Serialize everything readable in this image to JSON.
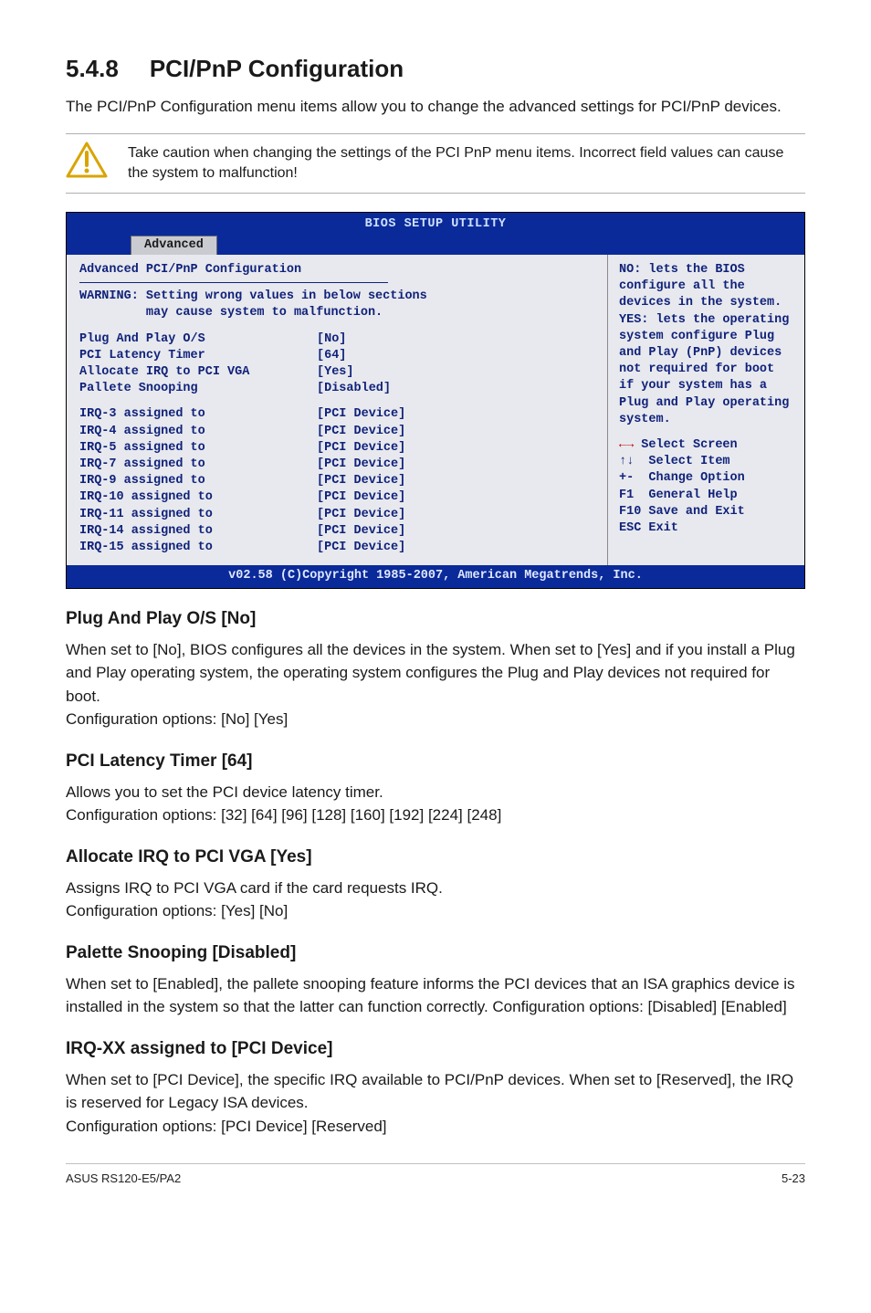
{
  "section": {
    "number": "5.4.8",
    "title": "PCI/PnP Configuration",
    "lead": "The PCI/PnP Configuration menu items allow you to change the advanced settings for PCI/PnP devices.",
    "note": "Take caution when changing the settings of the PCI PnP menu items. Incorrect field values can cause the system to malfunction!"
  },
  "bios": {
    "title": "BIOS SETUP UTILITY",
    "tab": "Advanced",
    "left_header": "Advanced PCI/PnP Configuration",
    "warning_line1": "WARNING: Setting wrong values in below sections",
    "warning_line2": "         may cause system to malfunction.",
    "group1": [
      {
        "label": "Plug And Play O/S",
        "value": "[No]"
      },
      {
        "label": "PCI Latency Timer",
        "value": "[64]"
      },
      {
        "label": "Allocate IRQ to PCI VGA",
        "value": "[Yes]"
      },
      {
        "label": "Pallete Snooping",
        "value": "[Disabled]"
      }
    ],
    "group2": [
      {
        "label": "IRQ-3 assigned to",
        "value": "[PCI Device]"
      },
      {
        "label": "IRQ-4 assigned to",
        "value": "[PCI Device]"
      },
      {
        "label": "IRQ-5 assigned to",
        "value": "[PCI Device]"
      },
      {
        "label": "IRQ-7 assigned to",
        "value": "[PCI Device]"
      },
      {
        "label": "IRQ-9 assigned to",
        "value": "[PCI Device]"
      },
      {
        "label": "IRQ-10 assigned to",
        "value": "[PCI Device]"
      },
      {
        "label": "IRQ-11 assigned to",
        "value": "[PCI Device]"
      },
      {
        "label": "IRQ-14 assigned to",
        "value": "[PCI Device]"
      },
      {
        "label": "IRQ-15 assigned to",
        "value": "[PCI Device]"
      }
    ],
    "help_top": "NO: lets the BIOS configure all the devices in the system. YES: lets the operating system configure Plug and Play (PnP) devices not required for boot if your system has a Plug and Play operating system.",
    "keys": {
      "select_screen": " Select Screen",
      "select_item": "  Select Item",
      "change_option": "+-  Change Option",
      "general_help": "F1  General Help",
      "save_exit": "F10 Save and Exit",
      "esc_exit": "ESC Exit"
    },
    "copyright": "v02.58 (C)Copyright 1985-2007, American Megatrends, Inc."
  },
  "subs": [
    {
      "heading": "Plug And Play O/S [No]",
      "body": "When set to [No], BIOS configures all the devices in the system. When set to [Yes] and if you install a Plug and Play operating system, the operating system configures the Plug and Play devices not required for boot.\nConfiguration options: [No] [Yes]"
    },
    {
      "heading": "PCI Latency Timer [64]",
      "body": "Allows you to set the PCI device latency timer.\nConfiguration options: [32] [64] [96] [128] [160] [192] [224] [248]"
    },
    {
      "heading": "Allocate IRQ to PCI VGA [Yes]",
      "body": "Assigns IRQ to PCI VGA card if the card requests IRQ.\nConfiguration options: [Yes] [No]"
    },
    {
      "heading": "Palette Snooping [Disabled]",
      "body": "When set to [Enabled], the pallete snooping feature informs the PCI devices that an ISA graphics device is installed in the system so that the latter can function correctly. Configuration options: [Disabled] [Enabled]"
    },
    {
      "heading": "IRQ-XX assigned to [PCI Device]",
      "body": "When set to [PCI Device], the specific IRQ available to PCI/PnP devices. When set to [Reserved], the IRQ is reserved for Legacy ISA devices.\nConfiguration options: [PCI Device] [Reserved]"
    }
  ],
  "footer": {
    "left": "ASUS RS120-E5/PA2",
    "right": "5-23"
  }
}
